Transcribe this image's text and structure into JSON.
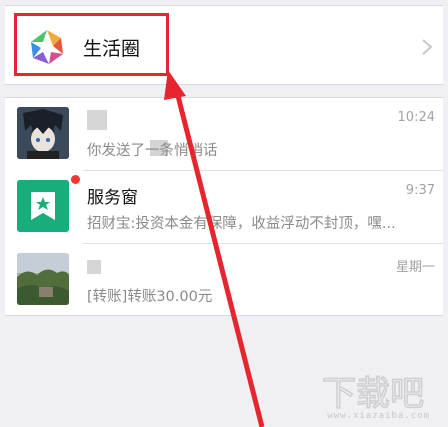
{
  "life_circle": {
    "label": "生活圈",
    "icon": "life-circle-icon",
    "chevron": "chevron-right-icon"
  },
  "chats": [
    {
      "name": "",
      "preview": "你发送了一条悄悄话",
      "time": "10:24",
      "avatar": "anime-avatar"
    },
    {
      "name": "服务窗",
      "preview": "招财宝:投资本金有保障，收益浮动不封顶，嘿...",
      "time": "9:37",
      "avatar": "service-window-icon",
      "unread": true
    },
    {
      "name": "",
      "preview": "[转账]转账30.00元",
      "time": "星期一",
      "avatar": "landscape-avatar"
    }
  ],
  "annotation": {
    "highlight_color": "#e6262e"
  },
  "watermark": {
    "text": "下载吧",
    "subtext": "www.xiazaiba.com"
  },
  "colors": {
    "service_green": "#1aad7c",
    "unread_red": "#f43530",
    "background": "#efeff4"
  }
}
